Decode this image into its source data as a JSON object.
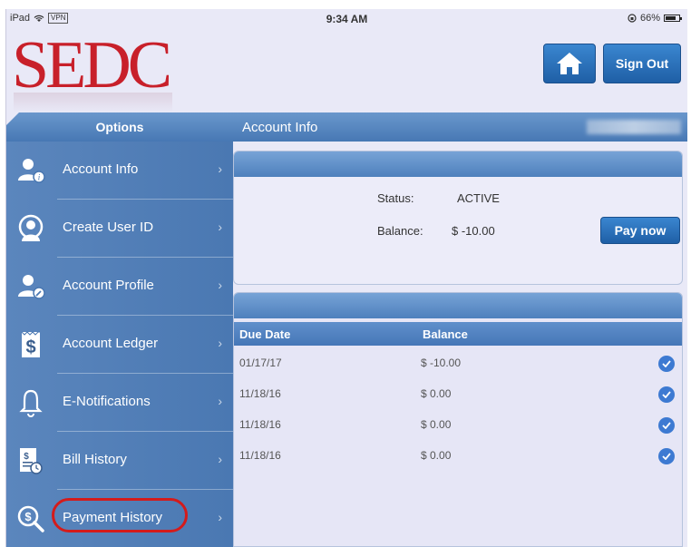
{
  "status_bar": {
    "device": "iPad",
    "vpn": "VPN",
    "time": "9:34 AM",
    "battery": "66%"
  },
  "header": {
    "logo_text": "SEDC",
    "sign_out_label": "Sign Out"
  },
  "sidebar": {
    "title": "Options",
    "items": [
      {
        "label": "Account Info",
        "icon": "user-info-icon"
      },
      {
        "label": "Create User ID",
        "icon": "user-circle-icon"
      },
      {
        "label": "Account Profile",
        "icon": "user-edit-icon"
      },
      {
        "label": "Account Ledger",
        "icon": "ledger-dollar-icon"
      },
      {
        "label": "E-Notifications",
        "icon": "bell-icon"
      },
      {
        "label": "Bill History",
        "icon": "bill-clock-icon"
      },
      {
        "label": "Payment History",
        "icon": "dollar-search-icon",
        "highlighted": true
      }
    ]
  },
  "main": {
    "title": "Account Info",
    "summary": {
      "status_label": "Status:",
      "status_value": "ACTIVE",
      "balance_label": "Balance:",
      "balance_value": "$ -10.00",
      "pay_now_label": "Pay now"
    },
    "history": {
      "columns": [
        "Due Date",
        "Balance"
      ],
      "rows": [
        {
          "due_date": "01/17/17",
          "balance": "$ -10.00"
        },
        {
          "due_date": "11/18/16",
          "balance": "$ 0.00"
        },
        {
          "due_date": "11/18/16",
          "balance": "$ 0.00"
        },
        {
          "due_date": "11/18/16",
          "balance": "$ 0.00"
        }
      ]
    }
  },
  "colors": {
    "brand_red": "#c8202a",
    "accent_blue": "#1f5fa6",
    "sidebar_blue": "#4a78b2",
    "highlight_ring": "#d41b1b"
  }
}
